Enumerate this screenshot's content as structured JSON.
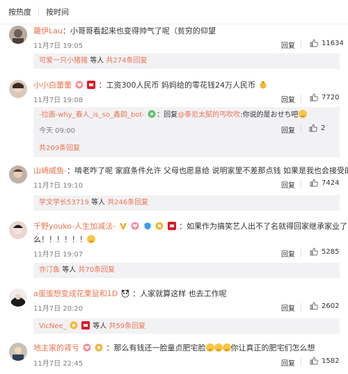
{
  "sort": {
    "hot": "按热度",
    "time": "按时间"
  },
  "reply_label": "回复",
  "others_suffix": "等人",
  "comments": [
    {
      "user": "蘿伊Lau",
      "text": "：小哥哥看起来也变得帅气了呢（贫穷的仰望",
      "time": "11月7日 19:05",
      "likes": "11634",
      "more_user": "可爱一只小猪猪",
      "more_count": "共274条回复"
    },
    {
      "user": "小小白蕾蕾",
      "text": "：工资300人民币 妈妈给的零花钱24万人民币",
      "time": "11月7日 19:08",
      "likes": "7720",
      "sub_user": "-拉面-why_春人_is_so_鑫韵_bot-",
      "sub_sep": "：回复",
      "sub_mention": "@泰尼太腻的丐吹吹",
      "sub_text": ":你说的是おせち吧",
      "sub_time": "今天 09:00",
      "sub_likes": "2",
      "more_count": "共209条回复"
    },
    {
      "user": "山崎威鱼-",
      "text": "：啃老咋了呢 家庭条件允许 父母也愿意给 说明家里不差那点钱 如果是我也会接受的",
      "time": "11月7日 19:10",
      "likes": "7424",
      "more_user": "学文学长53719",
      "more_count": "共246条回复"
    },
    {
      "user": "千野youko-人生加减法-",
      "text1": "：如果作为搞笑艺人出不了名就得回家继承家业了",
      "text2": "么！！！！！！",
      "time": "11月7日 19:07",
      "likes": "5285",
      "more_user": "亦汀鱼",
      "more_count": "共70条回复"
    },
    {
      "user": "a蛋蛋想变成花栗鼠和1D",
      "text": "：人家就算这样 也去工作呢",
      "time": "11月7日 20:20",
      "likes": "2602",
      "more_user": "VicNee_",
      "more_count": "共59条回复"
    },
    {
      "user": "地主家的肾亏",
      "text": "：那么有钱还一脸童贞肥宅脸",
      "text_b": "你让真正的肥宅们怎么想",
      "time": "11月7日 22:45",
      "likes": "1582"
    }
  ],
  "colors": {
    "link": "#eb7350",
    "subbg": "#f2f2f5"
  }
}
